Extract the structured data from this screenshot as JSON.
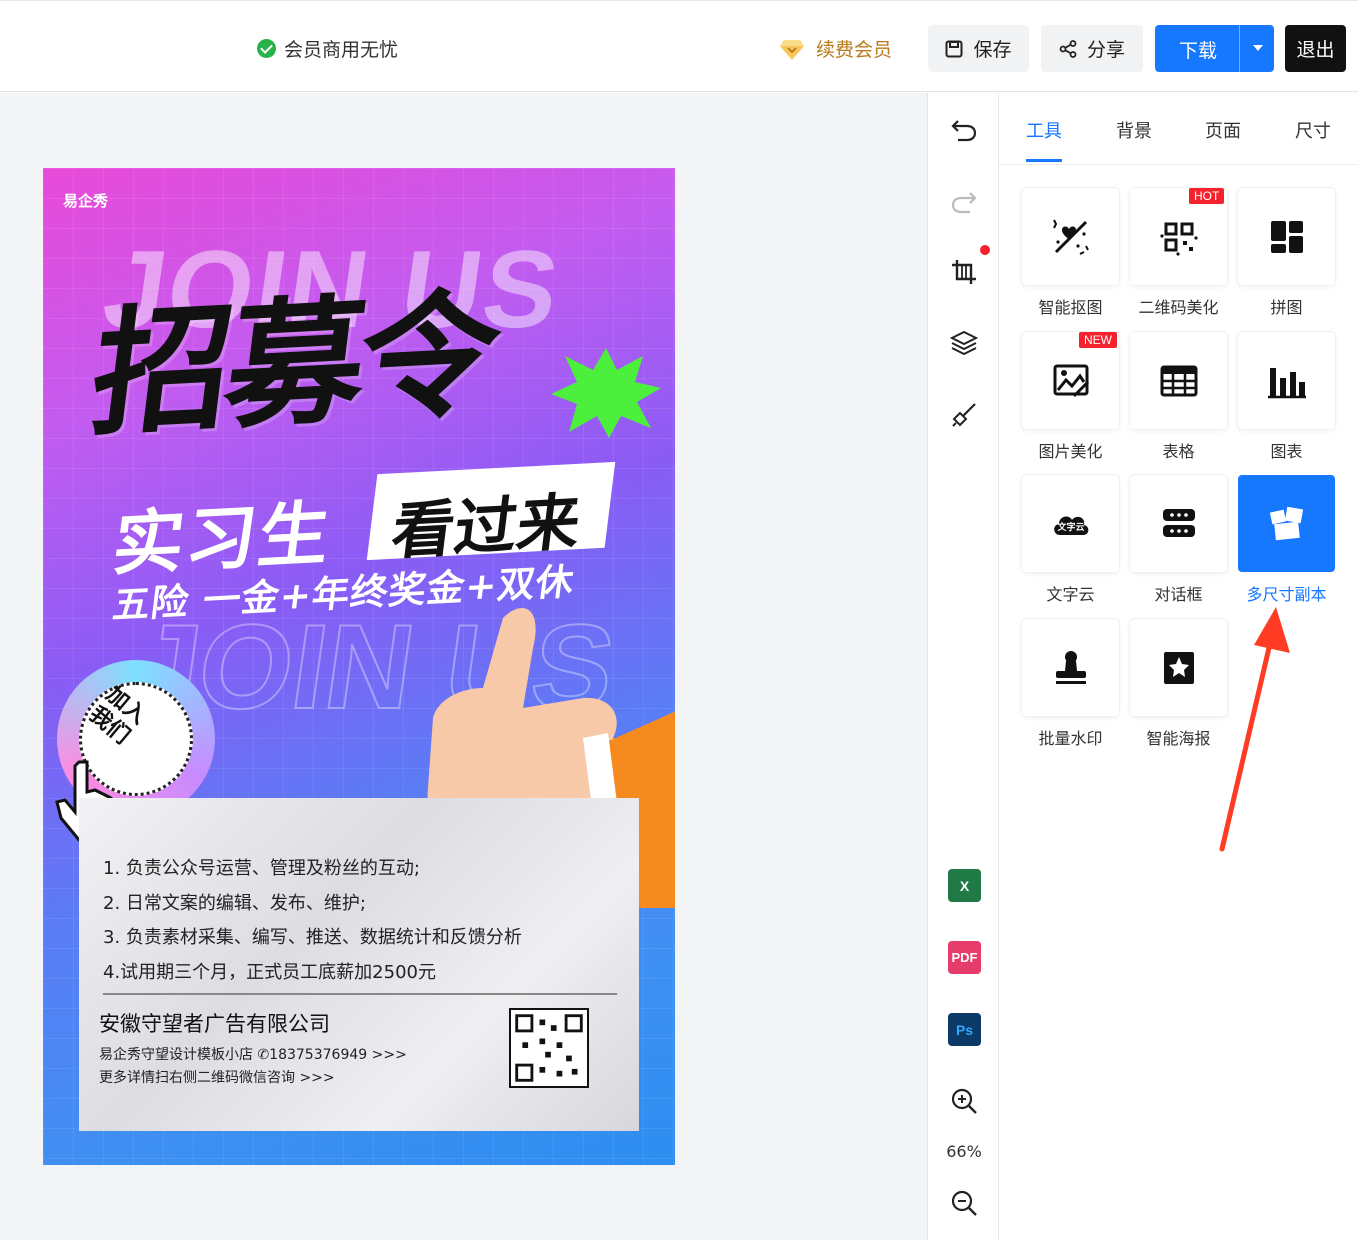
{
  "topbar": {
    "vip_note": "会员商用无忧",
    "renew_label": "续费会员",
    "save_label": "保存",
    "share_label": "分享",
    "download_label": "下载",
    "exit_label": "退出"
  },
  "poster": {
    "logo": "易企秀",
    "join_us": "JOIN US",
    "headline": "招募令",
    "intern": "实习生",
    "come": "看过来",
    "benefits": "五险 一金+年终奖金+双休",
    "badge": "加入我们",
    "duties": [
      "1. 负责公众号运营、管理及粉丝的互动;",
      "2. 日常文案的编辑、发布、维护;",
      "3. 负责素材采集、编写、推送、数据统计和反馈分析",
      "4.试用期三个月，正式员工底薪加2500元"
    ],
    "company": "安徽守望者广告有限公司",
    "shop_line": "易企秀守望设计模板小店 ✆18375376949 >>>",
    "more_line": "更多详情扫右侧二维码微信咨询 >>>"
  },
  "side_tools": {
    "zoom": "66%",
    "pdf_label": "PDF",
    "ps_label": "Ps",
    "excel_label": "X"
  },
  "panel": {
    "tabs": [
      "工具",
      "背景",
      "页面",
      "尺寸"
    ],
    "tools": [
      {
        "label": "智能抠图",
        "icon": "smart-cutout-icon"
      },
      {
        "label": "二维码美化",
        "icon": "qr-beautify-icon",
        "tag": "HOT"
      },
      {
        "label": "拼图",
        "icon": "collage-icon"
      },
      {
        "label": "图片美化",
        "icon": "image-beautify-icon",
        "tag": "NEW"
      },
      {
        "label": "表格",
        "icon": "table-icon"
      },
      {
        "label": "图表",
        "icon": "chart-icon"
      },
      {
        "label": "文字云",
        "icon": "word-cloud-icon"
      },
      {
        "label": "对话框",
        "icon": "dialog-box-icon"
      },
      {
        "label": "多尺寸副本",
        "icon": "multi-size-copy-icon"
      },
      {
        "label": "批量水印",
        "icon": "batch-watermark-icon"
      },
      {
        "label": "智能海报",
        "icon": "smart-poster-icon"
      }
    ],
    "word_cloud_icon_text": "文字云"
  },
  "colors": {
    "accent": "#1677ff",
    "vip_gold": "#b97a1a",
    "tag_red": "#f5222d",
    "exit_black": "#111111"
  }
}
